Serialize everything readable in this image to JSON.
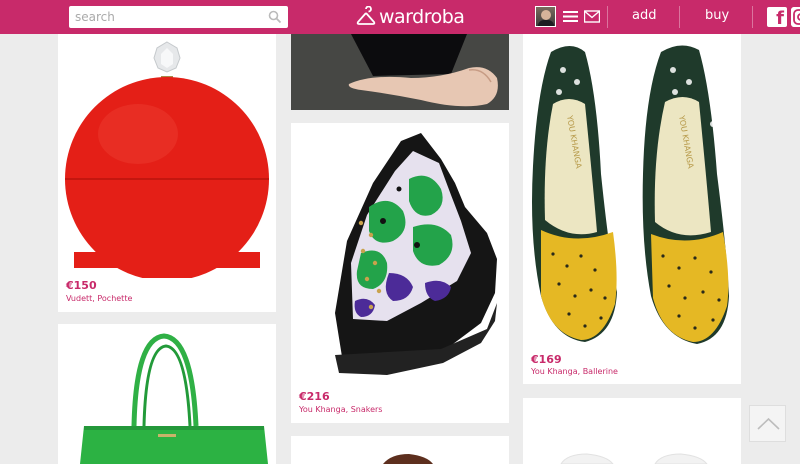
{
  "header": {
    "search_placeholder": "search",
    "logo_text": "wardroba",
    "nav": {
      "add_label": "add",
      "buy_label": "buy"
    },
    "icons": [
      "search-icon",
      "hanger-logo",
      "avatar",
      "menu-icon",
      "mail-icon",
      "facebook-icon",
      "instagram-icon"
    ],
    "brand_color": "#c82a6a"
  },
  "products": [
    {
      "price": "€150",
      "description": "Vudett, Pochette",
      "image": "red-round-clutch"
    },
    {
      "price": "€216",
      "description": "You Khanga, Snakers",
      "image": "printed-high-top-sneaker"
    },
    {
      "price": "€169",
      "description": "You Khanga, Ballerine",
      "image": "printed-loafer-flats"
    }
  ],
  "product_images": {
    "loafer_inner_label": "YOU KHANGA"
  },
  "scroll_top_icon": "chevron-up-icon"
}
